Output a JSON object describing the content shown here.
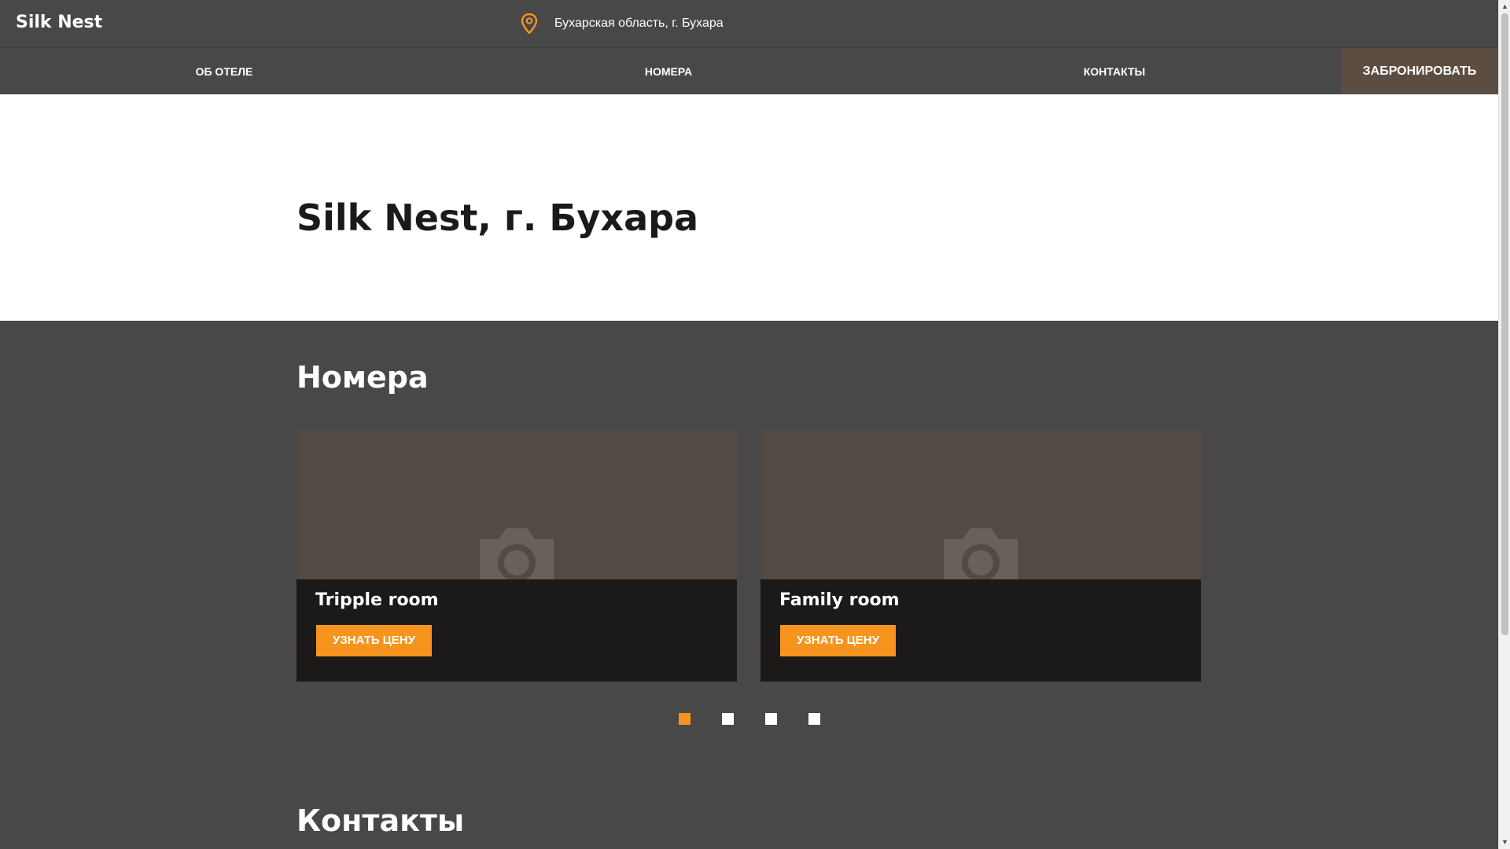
{
  "header": {
    "brand": "Silk Nest",
    "location": "Бухарская область, г. Бухара",
    "location_icon": "map-pin-icon"
  },
  "nav": {
    "items": [
      {
        "label": "ОБ ОТЕЛЕ"
      },
      {
        "label": "НОМЕРА"
      },
      {
        "label": "КОНТАКТЫ"
      }
    ],
    "book_label": "ЗАБРОНИРОВАТЬ"
  },
  "hero": {
    "title": "Silk Nest, г. Бухара"
  },
  "rooms": {
    "title": "Номера",
    "cards": [
      {
        "name": "Tripple room",
        "button": "УЗНАТЬ ЦЕНУ",
        "image_icon": "camera-icon"
      },
      {
        "name": "Family room",
        "button": "УЗНАТЬ ЦЕНУ",
        "image_icon": "camera-icon"
      }
    ],
    "pagination": {
      "pages": 4,
      "active": 1
    }
  },
  "contacts": {
    "title": "Контакты"
  },
  "colors": {
    "background": "#484848",
    "accent": "#f7941d",
    "book_button": "#5b4d42",
    "card_dark": "#1c1a18",
    "photo_placeholder": "#544a44"
  }
}
